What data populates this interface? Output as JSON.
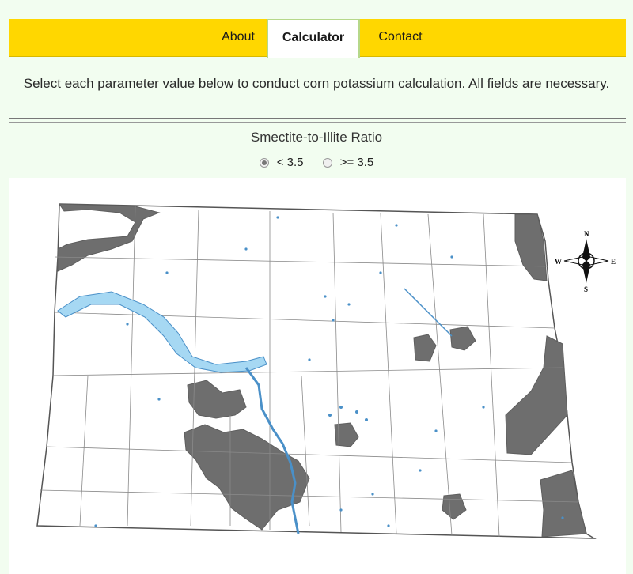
{
  "nav": {
    "tabs": [
      {
        "label": "About"
      },
      {
        "label": "Calculator"
      },
      {
        "label": "Contact"
      }
    ]
  },
  "intro": {
    "text": "Select each parameter value below to conduct corn potassium calculation. All fields are necessary."
  },
  "parameter": {
    "title": "Smectite-to-Illite Ratio",
    "options": [
      {
        "label": "< 3.5",
        "selected": true
      },
      {
        "label": ">= 3.5",
        "selected": false
      }
    ]
  },
  "map": {
    "compass": {
      "n": "N",
      "s": "S",
      "e": "E",
      "w": "W"
    },
    "colors": {
      "zone": "#6e6e6e",
      "water": "#a6d8f3",
      "water_line": "#4a90c8",
      "county_line": "#7a7a7a"
    }
  }
}
